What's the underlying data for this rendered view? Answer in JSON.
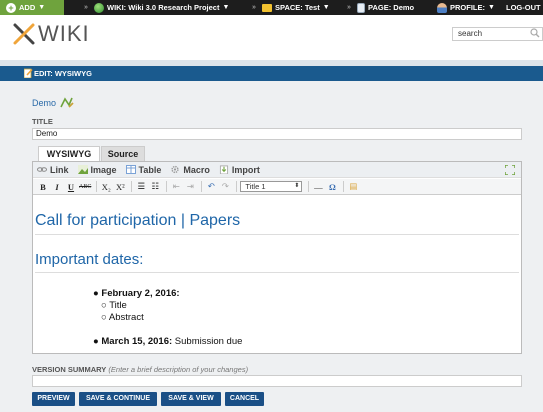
{
  "topbar": {
    "add": "ADD",
    "wiki": "WIKI: Wiki 3.0 Research Project",
    "space": "SPACE: Test",
    "page": "PAGE: Demo",
    "profile": "PROFILE:",
    "logout": "LOG-OUT",
    "separator": "»"
  },
  "header": {
    "logo_text": "WIKI",
    "search_value": "search"
  },
  "editbar": {
    "title": "EDIT: WYSIWYG"
  },
  "doc": {
    "link": "Demo",
    "title_label": "TITLE",
    "title_value": "Demo"
  },
  "tabs": [
    {
      "label": "WYSIWYG",
      "active": true
    },
    {
      "label": "Source",
      "active": false
    }
  ],
  "toolbar": {
    "link": "Link",
    "image": "Image",
    "table": "Table",
    "macro": "Macro",
    "import": "Import",
    "bold": "B",
    "italic": "I",
    "underline": "U",
    "strike": "ABC",
    "subscript": "X₂",
    "superscript": "X²",
    "style_value": "Title 1",
    "hr": "—",
    "omega": "Ω"
  },
  "content": {
    "heading1": "Call for participation | Papers",
    "heading2": "Important dates:",
    "bullet1": "February 2, 2016:",
    "sub1": "Title",
    "sub2": "Abstract",
    "bullet2_date": "March 15, 2016:",
    "bullet2_text": " Submission due"
  },
  "version_summary": {
    "label": "VERSION SUMMARY",
    "hint": "(Enter a brief description of your changes)"
  },
  "buttons": {
    "preview": "PREVIEW",
    "save_continue": "SAVE & CONTINUE",
    "save_view": "SAVE & VIEW",
    "cancel": "CANCEL"
  },
  "colors": {
    "topbar": "#1d1d1d",
    "add": "#6fa33d",
    "editbar": "#1a5a8e",
    "heading": "#1f66a8",
    "button": "#1a4f86"
  }
}
